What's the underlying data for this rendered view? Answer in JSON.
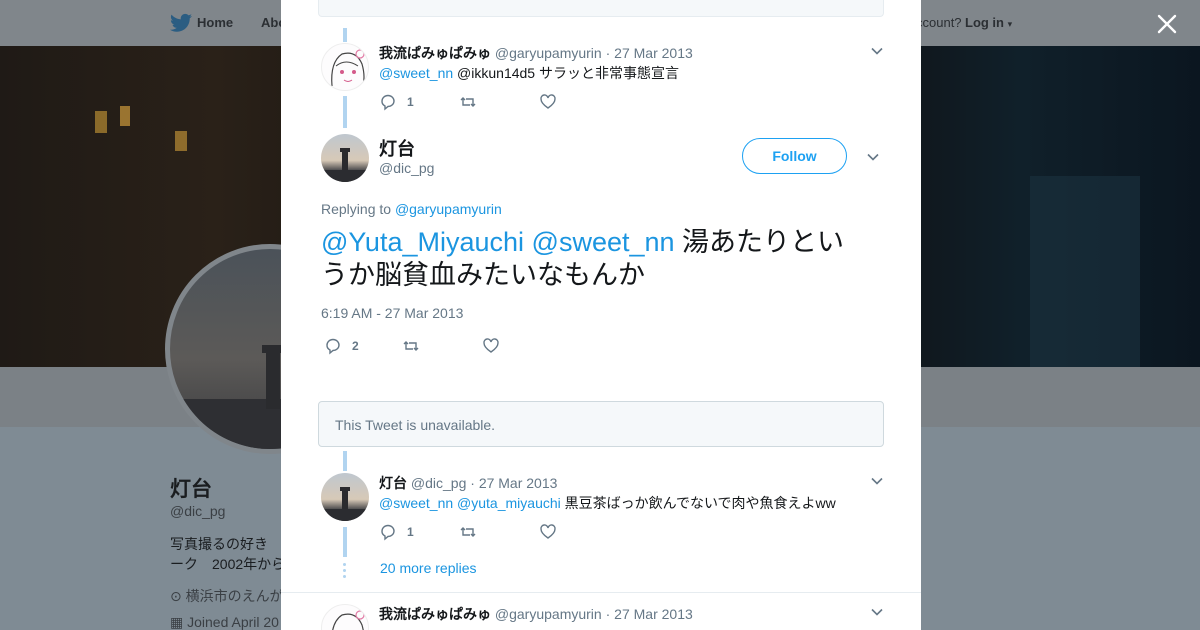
{
  "background": {
    "nav": {
      "home": "Home",
      "about": "Abo",
      "account_q": "ccount?",
      "login": "Log in"
    },
    "profile": {
      "name": "灯台",
      "handle": "@dic_pg",
      "bio_line1": "写真撮るの好き",
      "bio_line2": "ーク　2002年から",
      "location": "横浜市のえんが",
      "joined": "Joined April 20"
    }
  },
  "thread": {
    "tweet1": {
      "name": "我流ぱみゅぱみゅ",
      "handle": "@garyupamyurin",
      "sep": "·",
      "date": "27 Mar 2013",
      "mention": "@sweet_nn",
      "text": "@ikkun14d5 サラッと非常事態宣言",
      "replies": "1"
    },
    "main": {
      "name": "灯台",
      "handle": "@dic_pg",
      "follow_label": "Follow",
      "replying_prefix": "Replying to",
      "replying_to": "@garyupamyurin",
      "mention1": "@Yuta_Miyauchi",
      "mention2": "@sweet_nn",
      "text": "湯あたりというか脳貧血みたいなもんか",
      "timestamp": "6:19 AM - 27 Mar 2013",
      "replies": "2"
    },
    "unavailable": "This Tweet is unavailable.",
    "tweet3": {
      "name": "灯台",
      "handle": "@dic_pg",
      "sep": "·",
      "date": "27 Mar 2013",
      "mention1": "@sweet_nn",
      "mention2": "@yuta_miyauchi",
      "text": "黒豆茶ばっか飲んでないで肉や魚食えよww",
      "replies": "1"
    },
    "more_replies": "20 more replies",
    "tweet4": {
      "name": "我流ぱみゅぱみゅ",
      "handle": "@garyupamyurin",
      "sep": "·",
      "date": "27 Mar 2013"
    }
  },
  "icons": [
    "twitter-bird-icon",
    "close-icon",
    "chevron-down-icon",
    "reply-icon",
    "retweet-icon",
    "like-icon",
    "location-pin-icon",
    "calendar-icon"
  ],
  "colors": {
    "link": "#1b95e0",
    "accent": "#1da1f2",
    "thread_line": "#b1d4f0",
    "muted": "#657786"
  }
}
